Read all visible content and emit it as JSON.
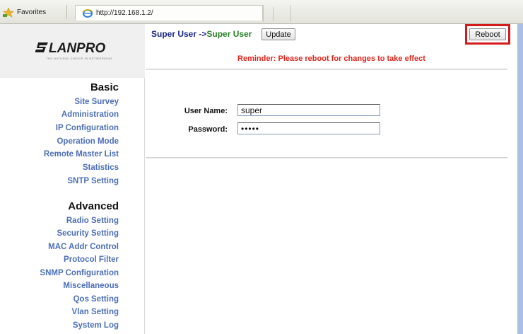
{
  "browser": {
    "favorites_label": "Favorites",
    "url": "http://192.168.1.2/"
  },
  "brand": {
    "logo_text": "LANPRO",
    "tagline": "THE NATURAL CHOICE IN NETWORKING"
  },
  "sidebar": {
    "basic_heading": "Basic",
    "basic_items": [
      {
        "label": "Site Survey"
      },
      {
        "label": "Administration"
      },
      {
        "label": "IP Configuration"
      },
      {
        "label": "Operation Mode"
      },
      {
        "label": "Remote Master List"
      },
      {
        "label": "Statistics"
      },
      {
        "label": "SNTP Setting"
      }
    ],
    "advanced_heading": "Advanced",
    "advanced_items": [
      {
        "label": "Radio Setting"
      },
      {
        "label": "Security Setting"
      },
      {
        "label": "MAC Addr Control"
      },
      {
        "label": "Protocol Filter"
      },
      {
        "label": "SNMP Configuration"
      },
      {
        "label": "Miscellaneous"
      },
      {
        "label": "Qos Setting"
      },
      {
        "label": "Vlan Setting"
      },
      {
        "label": "System Log"
      }
    ]
  },
  "header": {
    "breadcrumb_prefix": "Super User ->",
    "breadcrumb_current": "Super User",
    "update_label": "Update",
    "reboot_label": "Reboot",
    "reminder": "Reminder: Please reboot for changes to take effect"
  },
  "form": {
    "username_label": "User Name:",
    "username_value": "super",
    "password_label": "Password:",
    "password_value": "•••••"
  },
  "colors": {
    "nav_link": "#4b6fb8",
    "reminder": "#e0261d",
    "highlight": "#d31b1b"
  }
}
